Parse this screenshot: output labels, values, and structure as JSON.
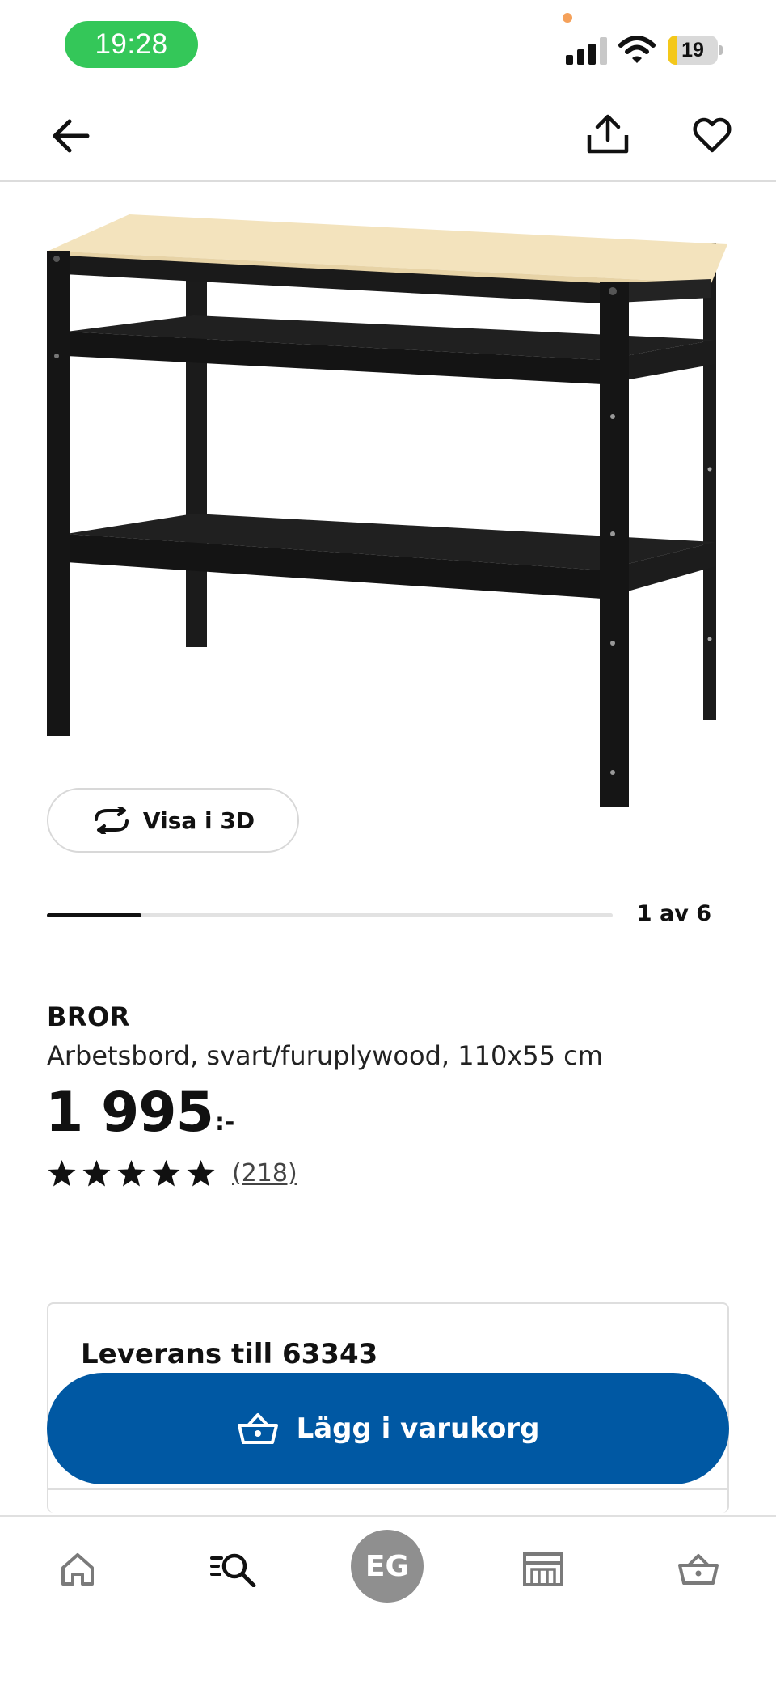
{
  "status_bar": {
    "time": "19:28",
    "battery_level": "19",
    "battery_fraction": 0.19,
    "icons": [
      "cellular-signal-icon",
      "wifi-icon",
      "battery-icon"
    ]
  },
  "nav": {
    "icons": [
      "back-arrow-icon",
      "share-icon",
      "heart-icon"
    ]
  },
  "gallery": {
    "view3d_label": "Visa i 3D",
    "counter": "1 av 6",
    "progress_fraction": 0.1667
  },
  "product": {
    "brand": "BROR",
    "description": "Arbetsbord, svart/furuplywood, 110x55 cm",
    "price": "1 995",
    "price_suffix": ":-",
    "rating_stars": 5,
    "review_count": "(218)"
  },
  "delivery": {
    "title": "Leverans till 63343"
  },
  "cta": {
    "add_to_cart_label": "Lägg i varukorg"
  },
  "tab_bar": {
    "profile_initials": "EG",
    "icons": [
      "home-icon",
      "search-icon",
      "stores-icon",
      "cart-icon"
    ]
  },
  "colors": {
    "accent_blue": "#0058a3",
    "status_green": "#34c759",
    "battery_yellow": "#f4c81a"
  }
}
